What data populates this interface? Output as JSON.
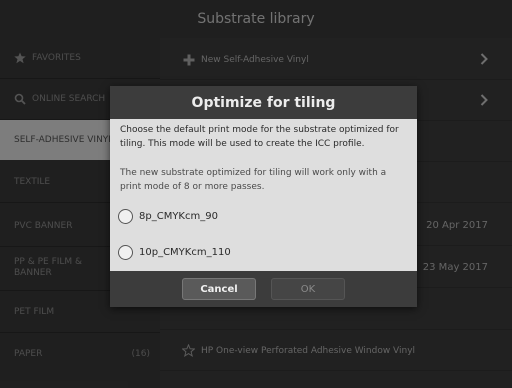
{
  "window": {
    "title": "Substrate library"
  },
  "sidebar": {
    "items": [
      {
        "label": "FAVORITES",
        "icon": "star-icon"
      },
      {
        "label": "ONLINE SEARCH",
        "icon": "search-icon"
      },
      {
        "label": "SELF-ADHESIVE VINYL",
        "selected": true
      },
      {
        "label": "TEXTILE"
      },
      {
        "label": "PVC BANNER"
      },
      {
        "label": "PP & PE FILM & BANNER"
      },
      {
        "label": "PET FILM"
      },
      {
        "label": "PAPER",
        "count": "(16)"
      }
    ]
  },
  "main": {
    "rows": [
      {
        "label": "New Self-Adhesive Vinyl",
        "icon": "plus-icon"
      },
      {
        "label": "",
        "icon": ""
      },
      {
        "label": "",
        "date": ""
      },
      {
        "label": "",
        "date": ""
      },
      {
        "label": "",
        "date": "20 Apr 2017"
      },
      {
        "label": "",
        "date": "23 May 2017"
      },
      {
        "label": ""
      },
      {
        "label": "HP One-view Perforated Adhesive Window Vinyl",
        "icon": "star-outline-icon"
      }
    ]
  },
  "dialog": {
    "title": "Optimize for tiling",
    "text1": "Choose the default print mode for the substrate optimized for tiling. This mode will be used to create the ICC profile.",
    "text2": "The new substrate optimized for tiling will work only with a print mode of 8 or more passes.",
    "options": [
      {
        "label": "8p_CMYKcm_90"
      },
      {
        "label": "10p_CMYKcm_110"
      }
    ],
    "cancel_label": "Cancel",
    "ok_label": "OK"
  }
}
